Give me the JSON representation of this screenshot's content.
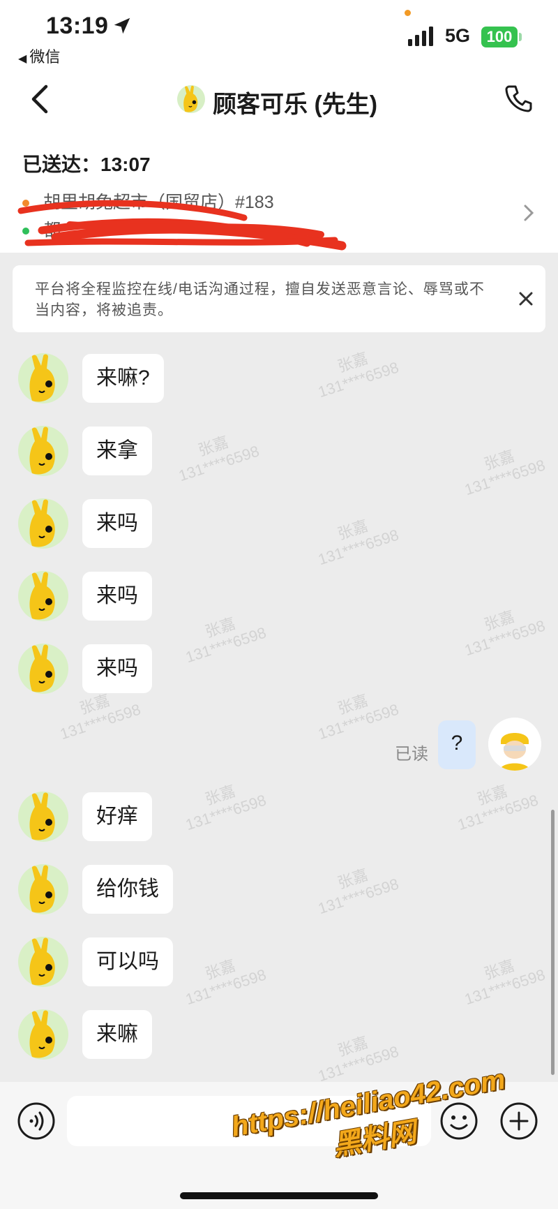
{
  "status_bar": {
    "time": "13:19",
    "back_app": "微信",
    "network": "5G",
    "battery": "100"
  },
  "nav": {
    "title": "顾客可乐 (先生)"
  },
  "order": {
    "status": "已送达：13:07",
    "store": "胡里胡兔超市（国贸店）#183",
    "address": "都"
  },
  "notice": {
    "text": "平台将全程监控在线/电话沟通过程，擅自发送恶意言论、辱骂或不当内容，将被追责。"
  },
  "messages": [
    {
      "from": "customer",
      "text": "来嘛?"
    },
    {
      "from": "customer",
      "text": "来拿"
    },
    {
      "from": "customer",
      "text": "来吗"
    },
    {
      "from": "customer",
      "text": "来吗"
    },
    {
      "from": "customer",
      "text": "来吗"
    },
    {
      "from": "me",
      "text": "?",
      "read_label": "已读"
    },
    {
      "from": "customer",
      "text": "好痒"
    },
    {
      "from": "customer",
      "text": "给你钱"
    },
    {
      "from": "customer",
      "text": "可以吗"
    },
    {
      "from": "customer",
      "text": "来嘛"
    }
  ],
  "chat_watermark": {
    "name": "张嘉",
    "number": "131****6598"
  },
  "input": {
    "placeholder": ""
  },
  "site_watermark": {
    "url": "https://heiliao42.com",
    "name": "黑料网"
  },
  "colors": {
    "accent_green": "#35c24f",
    "brand_yellow": "#f5c518",
    "chat_background": "#ececec",
    "my_bubble": "#d9e8fb"
  }
}
